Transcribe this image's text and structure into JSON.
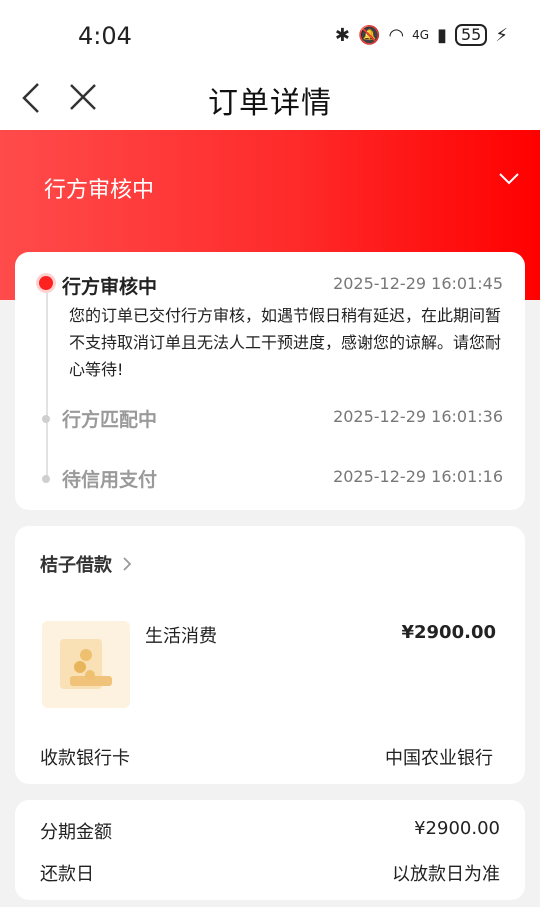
{
  "status_bar": {
    "time": "4:04",
    "signal": "4G",
    "battery": "55"
  },
  "nav": {
    "title": "订单详情"
  },
  "header": {
    "status": "行方审核中"
  },
  "timeline": [
    {
      "title": "行方审核中",
      "time": "2025-12-29 16:01:45",
      "description": "您的订单已交付行方审核，如遇节假日稍有延迟，在此期间暂不支持取消订单且无法人工干预进度，感谢您的谅解。请您耐心等待!",
      "active": true
    },
    {
      "title": "行方匹配中",
      "time": "2025-12-29 16:01:36",
      "active": false
    },
    {
      "title": "待信用支付",
      "time": "2025-12-29 16:01:16",
      "active": false
    }
  ],
  "loan": {
    "provider": "桔子借款",
    "product_name": "生活消费",
    "price": "¥2900.00",
    "bank_label": "收款银行卡",
    "bank_value": "中国农业银行"
  },
  "summary": {
    "amount_label": "分期金额",
    "amount_value": "¥2900.00",
    "repay_label": "还款日",
    "repay_value": "以放款日为准"
  },
  "colors": {
    "accent": "#ff2020",
    "header_gradient_start": "#ff4b4b",
    "header_gradient_end": "#ff0000"
  }
}
